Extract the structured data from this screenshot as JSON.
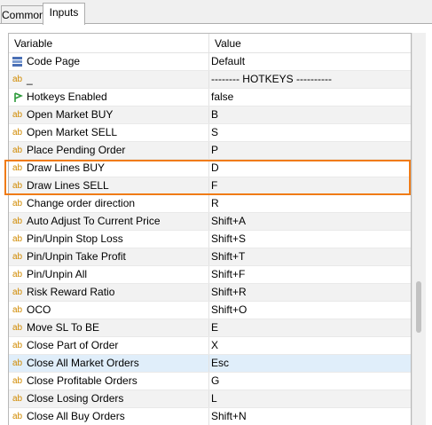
{
  "tabs": {
    "common": "Common",
    "inputs": "Inputs"
  },
  "columns": {
    "variable": "Variable",
    "value": "Value"
  },
  "rows": [
    {
      "icon": "code-page-icon",
      "variable": "Code Page",
      "value": "Default"
    },
    {
      "icon": "ab",
      "variable": "_",
      "value": "-------- HOTKEYS ----------"
    },
    {
      "icon": "flag-icon",
      "variable": "Hotkeys Enabled",
      "value": "false"
    },
    {
      "icon": "ab",
      "variable": "Open Market BUY",
      "value": "B"
    },
    {
      "icon": "ab",
      "variable": "Open Market SELL",
      "value": "S"
    },
    {
      "icon": "ab",
      "variable": "Place Pending Order",
      "value": "P"
    },
    {
      "icon": "ab",
      "variable": "Draw Lines BUY",
      "value": "D"
    },
    {
      "icon": "ab",
      "variable": "Draw Lines SELL",
      "value": "F"
    },
    {
      "icon": "ab",
      "variable": "Change order direction",
      "value": "R"
    },
    {
      "icon": "ab",
      "variable": "Auto Adjust To Current Price",
      "value": "Shift+A"
    },
    {
      "icon": "ab",
      "variable": "Pin/Unpin Stop Loss",
      "value": "Shift+S"
    },
    {
      "icon": "ab",
      "variable": "Pin/Unpin Take Profit",
      "value": "Shift+T"
    },
    {
      "icon": "ab",
      "variable": "Pin/Unpin All",
      "value": "Shift+F"
    },
    {
      "icon": "ab",
      "variable": "Risk Reward Ratio",
      "value": "Shift+R"
    },
    {
      "icon": "ab",
      "variable": "OCO",
      "value": "Shift+O"
    },
    {
      "icon": "ab",
      "variable": "Move SL To BE",
      "value": "E"
    },
    {
      "icon": "ab",
      "variable": "Close Part of Order",
      "value": "X"
    },
    {
      "icon": "ab",
      "variable": "Close All Market Orders",
      "value": "Esc"
    },
    {
      "icon": "ab",
      "variable": "Close Profitable Orders",
      "value": "G"
    },
    {
      "icon": "ab",
      "variable": "Close Losing Orders",
      "value": "L"
    },
    {
      "icon": "ab",
      "variable": "Close All Buy Orders",
      "value": "Shift+N"
    }
  ],
  "icon_text": "ab",
  "colors": {
    "highlight": "#f07b16",
    "selected_row": "#e0eefa",
    "ab_icon": "#d08a00"
  }
}
